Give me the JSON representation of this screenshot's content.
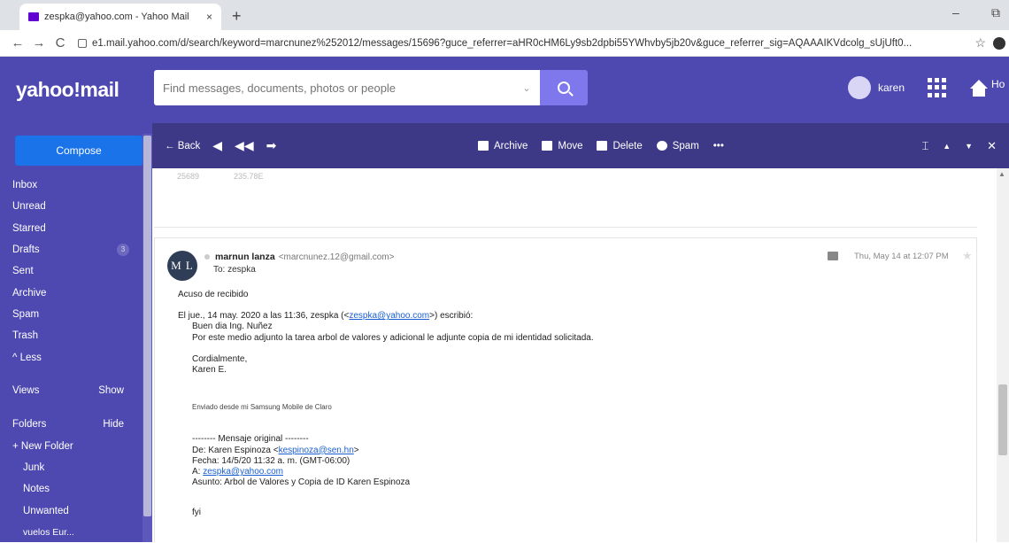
{
  "browser": {
    "tab_title": "zespka@yahoo.com - Yahoo Mail",
    "tab_close": "×",
    "new_tab": "+",
    "minimize": "–",
    "restore": "⧉",
    "back": "←",
    "forward": "→",
    "reload": "C",
    "url": "e1.mail.yahoo.com/d/search/keyword=marcnunez%252012/messages/15696?guce_referrer=aHR0cHM6Ly9sb2dpbi55YWhvby5jb20v&guce_referrer_sig=AQAAAIKVdcolg_sUjUft0...",
    "bookmark_star": "☆"
  },
  "header": {
    "logo": "yahoo!mail",
    "search_placeholder": "Find messages, documents, photos or people",
    "caret": "⌄",
    "user_name": "karen",
    "home_label": "Ho"
  },
  "sidebar": {
    "compose": "Compose",
    "folders": [
      {
        "label": "Inbox"
      },
      {
        "label": "Unread"
      },
      {
        "label": "Starred"
      },
      {
        "label": "Drafts",
        "count": "3"
      },
      {
        "label": "Sent"
      },
      {
        "label": "Archive"
      },
      {
        "label": "Spam"
      },
      {
        "label": "Trash"
      },
      {
        "label": "^ Less"
      }
    ],
    "views": {
      "label": "Views",
      "action": "Show"
    },
    "folders_section": {
      "label": "Folders",
      "action": "Hide"
    },
    "custom": [
      "+ New Folder",
      "Junk",
      "Notes",
      "Unwanted",
      "vuelos Eur..."
    ]
  },
  "toolbar": {
    "back": "← Back",
    "reply": "◀",
    "reply_all": "◀◀",
    "forward": "➡",
    "archive": "Archive",
    "move": "Move",
    "delete": "Delete",
    "spam": "Spam",
    "more": "•••",
    "expand": "⌶",
    "up": "▲",
    "down": "▼",
    "close": "✕"
  },
  "message": {
    "prev_faint_1": "25689",
    "prev_faint_2": "235.78E",
    "avatar_initials": "M L",
    "sender_name": "marnun lanza",
    "sender_email": "<marcnunez.12@gmail.com>",
    "to": "To: zespka",
    "date": "Thu, May 14 at 12:07 PM",
    "star": "★",
    "line_ack": "Acuso de recibido",
    "quote_intro_a": "El jue., 14 may. 2020 a las 11:36, zespka (<",
    "quote_intro_link": "zespka@yahoo.com",
    "quote_intro_b": ">) escribió:",
    "q1": "Buen dia Ing. Nuñez",
    "q2": "Por este medio adjunto la tarea arbol de valores y adicional le adjunte copia de mi identidad solicitada.",
    "q3": "Cordialmente,",
    "q4": "Karen E.",
    "sent_from": "Enviado desde mi Samsung Mobile de Claro",
    "orig_header": "-------- Mensaje original --------",
    "de_a": "De: Karen Espinoza <",
    "de_link": "kespinoza@sen.hn",
    "de_b": ">",
    "fecha": "Fecha: 14/5/20 11:32 a. m. (GMT-06:00)",
    "a_label": "A: ",
    "a_link": "zespka@yahoo.com",
    "asunto": "Asunto: Arbol de Valores y Copia de ID Karen Espinoza",
    "fyi": "fyi"
  }
}
